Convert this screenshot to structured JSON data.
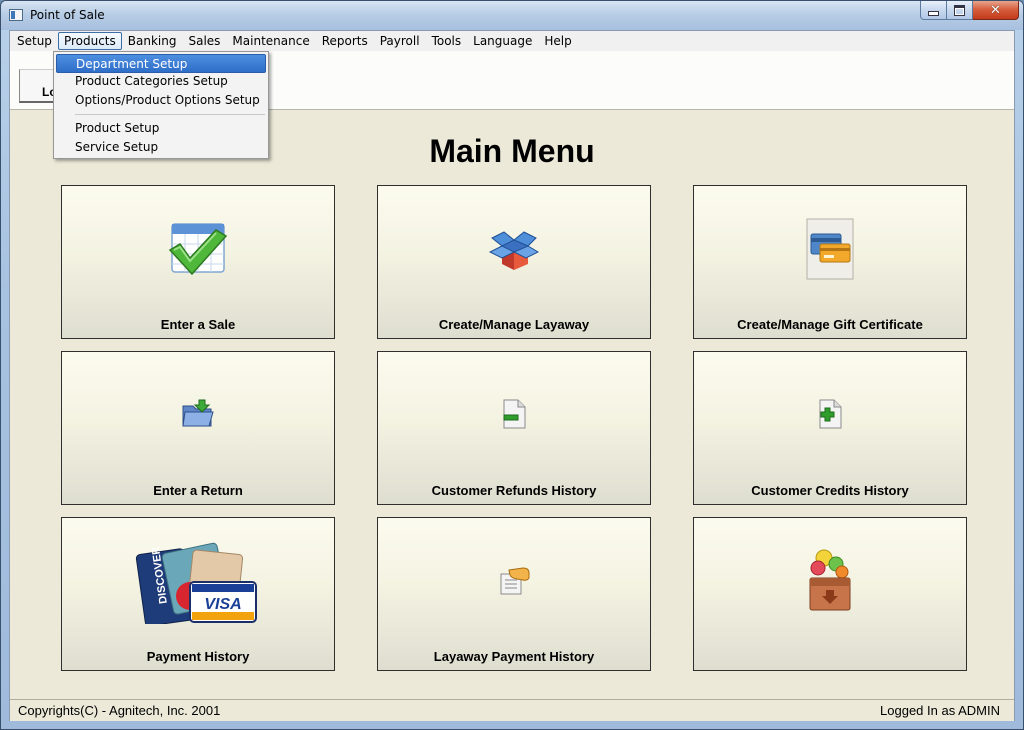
{
  "window": {
    "title": "Point of Sale",
    "close_glyph": "✕"
  },
  "menubar": {
    "items": [
      {
        "label": "Setup"
      },
      {
        "label": "Products",
        "active": true
      },
      {
        "label": "Banking"
      },
      {
        "label": "Sales"
      },
      {
        "label": "Maintenance"
      },
      {
        "label": "Reports"
      },
      {
        "label": "Payroll"
      },
      {
        "label": "Tools"
      },
      {
        "label": "Language"
      },
      {
        "label": "Help"
      }
    ]
  },
  "toolbar": {
    "tab_label": "Lo"
  },
  "dropdown": {
    "items": [
      {
        "label": "Department Setup",
        "highlighted": true
      },
      {
        "label": "Product Categories Setup"
      },
      {
        "label": "Options/Product Options Setup"
      },
      {
        "label": "Product Setup"
      },
      {
        "label": "Service Setup"
      }
    ]
  },
  "main": {
    "title": "Main Menu",
    "tiles": [
      {
        "label": "Enter a Sale",
        "icon": "checkmark-calendar-icon"
      },
      {
        "label": "Create/Manage Layaway",
        "icon": "open-box-icon"
      },
      {
        "label": "Create/Manage Gift Certificate",
        "icon": "gift-card-icon"
      },
      {
        "label": "Enter a Return",
        "icon": "folder-return-icon"
      },
      {
        "label": "Customer Refunds History",
        "icon": "document-minus-icon"
      },
      {
        "label": "Customer Credits History",
        "icon": "document-plus-icon"
      },
      {
        "label": "Payment History",
        "icon": "credit-cards-icon",
        "card_brand": "VISA",
        "card_brand_2": "DISCOVER"
      },
      {
        "label": "Layaway Payment History",
        "icon": "hand-document-icon"
      },
      {
        "label": "",
        "icon": "balloon-box-icon"
      }
    ]
  },
  "status": {
    "left": "Copyrights(C) - Agnitech, Inc. 2001",
    "right": "Logged In as ADMIN"
  },
  "colors": {
    "titlebar": "#b8cde6",
    "client_bg": "#ece9d8",
    "menu_highlight": "#2f6ec8",
    "close_button": "#c2391b"
  }
}
